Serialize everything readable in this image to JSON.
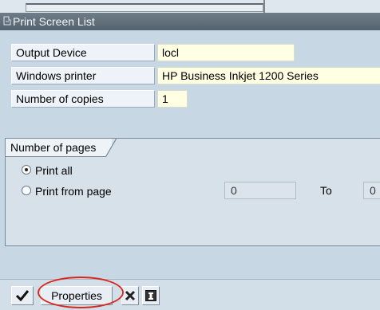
{
  "window": {
    "title": "Print Screen List"
  },
  "fields": {
    "output_device": {
      "label": "Output Device",
      "value": "locl"
    },
    "windows_printer": {
      "label": "Windows printer",
      "value": "HP Business Inkjet 1200 Series"
    },
    "copies": {
      "label": "Number of copies",
      "value": "1"
    }
  },
  "pages_group": {
    "title": "Number of pages",
    "print_all_label": "Print all",
    "print_from_label": "Print from page",
    "from_value": "0",
    "to_label": "To",
    "to_value": "0",
    "selected": "Print all"
  },
  "toolbar": {
    "properties_label": "Properties"
  },
  "colors": {
    "title_bar": "#55636f",
    "panel": "#c7d7e4",
    "input_bg": "#ffffe4",
    "highlight": "#d8281e"
  },
  "icons": {
    "confirm": "checkmark-icon",
    "cancel": "cancel-x-icon",
    "info": "info-icon",
    "title": "print-icon"
  }
}
